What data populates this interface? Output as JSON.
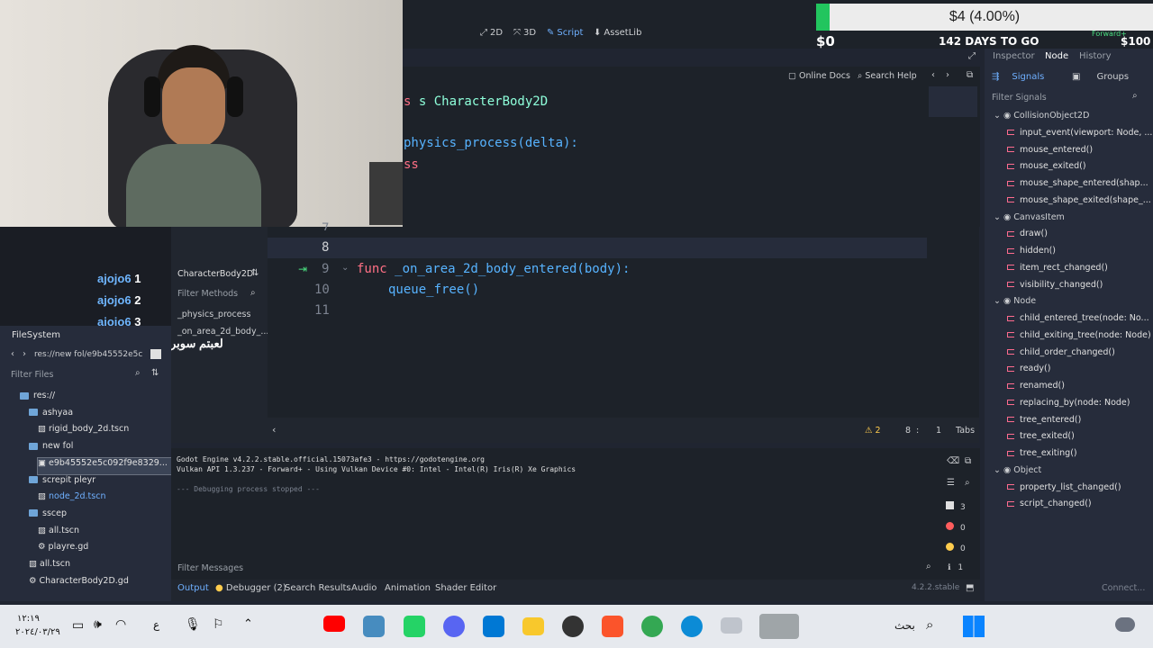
{
  "topbar": {
    "workspaces": [
      {
        "label": "2D",
        "icon": "2d-icon"
      },
      {
        "label": "3D",
        "icon": "3d-icon"
      },
      {
        "label": "Script",
        "icon": "script-icon",
        "active": true
      },
      {
        "label": "AssetLib",
        "icon": "assetlib-icon"
      }
    ]
  },
  "donation": {
    "amount": "$4 (4.00%)",
    "start": "$0",
    "days": "142 DAYS TO GO",
    "goal": "$100",
    "renderer": "Forward+",
    "progress_percent": 4
  },
  "script_toolbar": {
    "online_docs": "Online Docs",
    "search_help": "Search Help"
  },
  "code": {
    "top_lines": [
      {
        "text": "s CharacterBody2D"
      },
      {
        "text": "physics_process(delta):"
      },
      {
        "text": "ss"
      }
    ],
    "lines": [
      {
        "num": "8",
        "text": ""
      },
      {
        "num": "9",
        "kw": "func",
        "text": " _on_area_2d_body_entered(body):"
      },
      {
        "num": "10",
        "text": "queue_free()"
      },
      {
        "num": "11",
        "text": ""
      }
    ],
    "partial_num": "7",
    "status": {
      "warnings": "2",
      "line": "8",
      "sep": ":",
      "col": "1",
      "indent": "Tabs"
    }
  },
  "script_list": {
    "title": "CharacterBody2D",
    "filter_placeholder": "Filter Methods",
    "methods": [
      "_physics_process",
      "_on_area_2d_body_..."
    ]
  },
  "chat": {
    "lines": [
      {
        "user": "ajojo6",
        "msg": "1"
      },
      {
        "user": "ajojo6",
        "msg": "2"
      },
      {
        "user": "ajojo6",
        "msg": "3"
      },
      {
        "user": "ajojo6",
        "msg": "لعبتم سوبر ماركت"
      }
    ]
  },
  "filesystem": {
    "title": "FileSystem",
    "path": "res://new fol/e9b45552e5c",
    "filter_placeholder": "Filter Files",
    "items": [
      {
        "label": "res://",
        "type": "folder",
        "depth": 0
      },
      {
        "label": "ashyaa",
        "type": "folder",
        "depth": 1
      },
      {
        "label": "rigid_body_2d.tscn",
        "type": "scene",
        "depth": 2
      },
      {
        "label": "new fol",
        "type": "folder",
        "depth": 1
      },
      {
        "label": "e9b45552e5c092f9e8329...",
        "type": "image",
        "depth": 2,
        "selected": true
      },
      {
        "label": "screpit pleyr",
        "type": "folder",
        "depth": 1
      },
      {
        "label": "node_2d.tscn",
        "type": "scene",
        "depth": 2,
        "link": true
      },
      {
        "label": "sscep",
        "type": "folder",
        "depth": 1
      },
      {
        "label": "all.tscn",
        "type": "scene",
        "depth": 2
      },
      {
        "label": "playre.gd",
        "type": "script",
        "depth": 2
      },
      {
        "label": "all.tscn",
        "type": "scene",
        "depth": 1
      },
      {
        "label": "CharacterBody2D.gd",
        "type": "script",
        "depth": 1
      }
    ]
  },
  "inspector": {
    "tabs": [
      "Inspector",
      "Node",
      "History"
    ],
    "subtabs": [
      "Signals",
      "Groups"
    ],
    "filter_placeholder": "Filter Signals",
    "signals": [
      {
        "label": "CollisionObject2D",
        "group": true
      },
      {
        "label": "input_event(viewport: Node, ..."
      },
      {
        "label": "mouse_entered()"
      },
      {
        "label": "mouse_exited()"
      },
      {
        "label": "mouse_shape_entered(shap..."
      },
      {
        "label": "mouse_shape_exited(shape_..."
      },
      {
        "label": "CanvasItem",
        "group": true
      },
      {
        "label": "draw()"
      },
      {
        "label": "hidden()"
      },
      {
        "label": "item_rect_changed()"
      },
      {
        "label": "visibility_changed()"
      },
      {
        "label": "Node",
        "group": true
      },
      {
        "label": "child_entered_tree(node: No..."
      },
      {
        "label": "child_exiting_tree(node: Node)"
      },
      {
        "label": "child_order_changed()"
      },
      {
        "label": "ready()"
      },
      {
        "label": "renamed()"
      },
      {
        "label": "replacing_by(node: Node)"
      },
      {
        "label": "tree_entered()"
      },
      {
        "label": "tree_exited()"
      },
      {
        "label": "tree_exiting()"
      },
      {
        "label": "Object",
        "group": true
      },
      {
        "label": "property_list_changed()"
      },
      {
        "label": "script_changed()"
      }
    ],
    "connect": "Connect..."
  },
  "output": {
    "lines": [
      "Godot Engine v4.2.2.stable.official.15073afe3 - https://godotengine.org",
      "Vulkan API 1.3.237 - Forward+ - Using Vulkan Device #0: Intel - Intel(R) Iris(R) Xe Graphics",
      "",
      "--- Debugging process stopped ---"
    ],
    "filter_placeholder": "Filter Messages",
    "counts": {
      "messages": "3",
      "errors": "0",
      "warnings": "0",
      "info": "1"
    }
  },
  "bottom_tabs": [
    "Output",
    "Debugger (2)",
    "Search Results",
    "Audio",
    "Animation",
    "Shader Editor"
  ],
  "version": "4.2.2.stable",
  "taskbar": {
    "time": "١٢:١٩",
    "date": "٢٠٢٤/٠٣/٢٩",
    "lang": "ع",
    "search": "بحث"
  }
}
